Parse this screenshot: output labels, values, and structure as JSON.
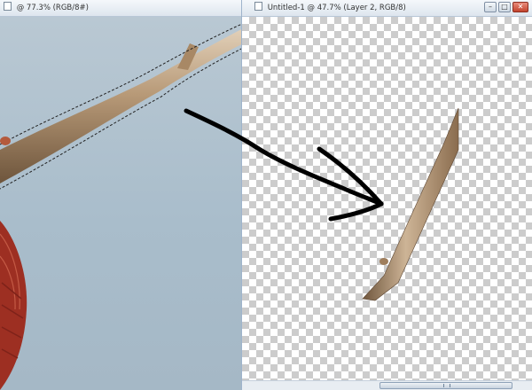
{
  "left_window": {
    "title": "@ 77.3% (RGB/8#)",
    "controls": {
      "minimize": "–",
      "maximize": "□",
      "close": "✕"
    }
  },
  "right_window": {
    "title": "Untitled-1 @ 47.7% (Layer 2, RGB/8)",
    "controls": {
      "minimize": "–",
      "maximize": "□",
      "close": "✕"
    }
  },
  "icons": {
    "scroll_up": "▲",
    "scroll_down": "▼"
  },
  "colors": {
    "sky": "#b3c3cf",
    "branch": "#a98b6a",
    "leaf": "#a83325",
    "arrow": "#000000"
  }
}
